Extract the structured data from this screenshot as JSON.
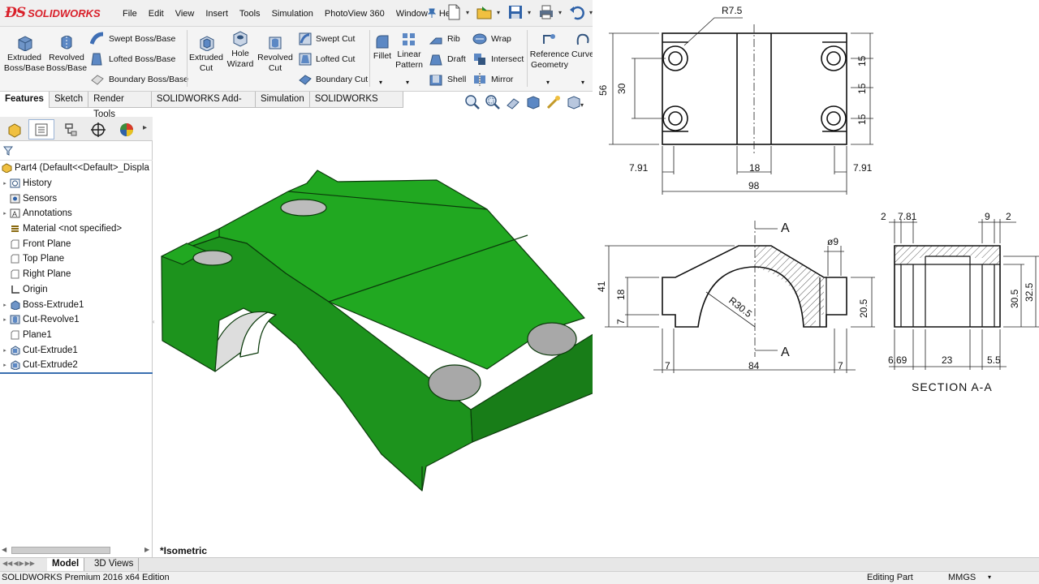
{
  "app": {
    "logo_text": "SOLIDWORKS",
    "accent": "#d9202a"
  },
  "menu": [
    "File",
    "Edit",
    "View",
    "Insert",
    "Tools",
    "Simulation",
    "PhotoView 360",
    "Window",
    "Help"
  ],
  "ribbon": {
    "extruded_boss": [
      "Extruded",
      "Boss/Base"
    ],
    "revolved_boss": [
      "Revolved",
      "Boss/Base"
    ],
    "swept_boss": "Swept Boss/Base",
    "lofted_boss": "Lofted Boss/Base",
    "boundary_boss": "Boundary Boss/Base",
    "extruded_cut": [
      "Extruded",
      "Cut"
    ],
    "hole_wizard": [
      "Hole",
      "Wizard"
    ],
    "revolved_cut": [
      "Revolved",
      "Cut"
    ],
    "swept_cut": "Swept Cut",
    "lofted_cut": "Lofted Cut",
    "boundary_cut": "Boundary Cut",
    "fillet": "Fillet",
    "linear_pattern": [
      "Linear",
      "Pattern"
    ],
    "rib": "Rib",
    "draft": "Draft",
    "shell": "Shell",
    "wrap": "Wrap",
    "intersect": "Intersect",
    "mirror": "Mirror",
    "reference_geometry": [
      "Reference",
      "Geometry"
    ],
    "curves": "Curve"
  },
  "tabs": [
    "Features",
    "Sketch",
    "Render Tools",
    "SOLIDWORKS Add-Ins",
    "Simulation",
    "SOLIDWORKS MBD"
  ],
  "tree": {
    "root": "Part4  (Default<<Default>_Displa",
    "items": [
      {
        "label": "History",
        "expandable": true
      },
      {
        "label": "Sensors",
        "expandable": false
      },
      {
        "label": "Annotations",
        "expandable": true
      },
      {
        "label": "Material <not specified>",
        "expandable": false
      },
      {
        "label": "Front Plane",
        "expandable": false
      },
      {
        "label": "Top Plane",
        "expandable": false
      },
      {
        "label": "Right Plane",
        "expandable": false
      },
      {
        "label": "Origin",
        "expandable": false
      },
      {
        "label": "Boss-Extrude1",
        "expandable": true
      },
      {
        "label": "Cut-Revolve1",
        "expandable": true
      },
      {
        "label": "Plane1",
        "expandable": false
      },
      {
        "label": "Cut-Extrude1",
        "expandable": true
      },
      {
        "label": "Cut-Extrude2",
        "expandable": true
      }
    ]
  },
  "view_label": "*Isometric",
  "bottom_tabs": [
    "Model",
    "3D Views"
  ],
  "status": {
    "edition": "SOLIDWORKS Premium 2016 x64 Edition",
    "mode": "Editing Part",
    "units": "MMGS"
  },
  "model_color": "#1fa01f",
  "drawing": {
    "top": {
      "r": "R7.5",
      "height": "56",
      "hole_spacing": "30",
      "v15": [
        "15",
        "15",
        "15"
      ],
      "left": "7.91",
      "mid": "18",
      "right": "7.91",
      "width": "98"
    },
    "front": {
      "section_label": "A",
      "h41": "41",
      "h18": "18",
      "h7": "7",
      "radius": "R30.5",
      "dia": "ø9",
      "h205": "20.5",
      "w7l": "7",
      "w84": "84",
      "w7r": "7"
    },
    "section": {
      "d2l": "2",
      "d781": "7.81",
      "d9": "9",
      "d2r": "2",
      "h305": "30.5",
      "h325": "32.5",
      "w669": "6.69",
      "w23": "23",
      "w55": "5.5",
      "title": "SECTION A-A"
    }
  }
}
